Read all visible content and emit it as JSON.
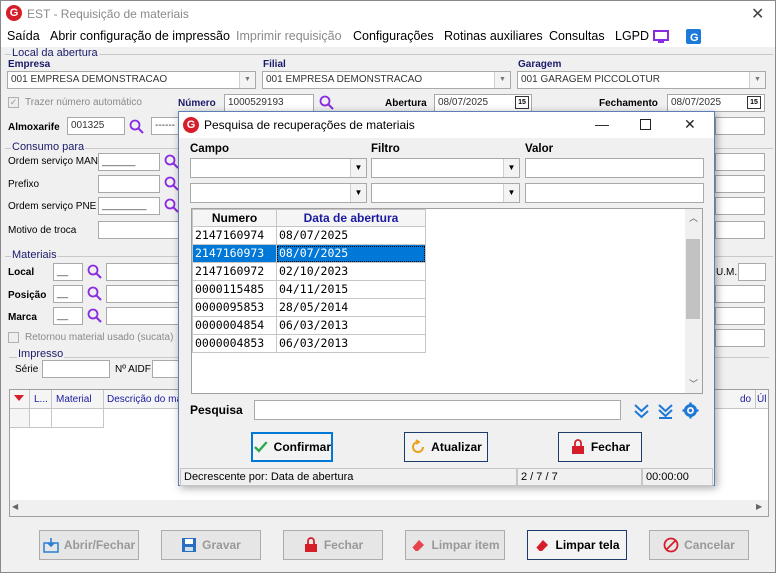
{
  "window": {
    "title": "EST - Requisição de materiais",
    "close": "✕"
  },
  "menu": [
    "Saída",
    "Abrir configuração de impressão",
    "Imprimir requisição",
    "Configurações",
    "Rotinas auxiliares",
    "Consultas",
    "LGPD"
  ],
  "local": {
    "group_title": "Local da abertura",
    "empresa_label": "Empresa",
    "empresa_value": "001 EMPRESA DEMONSTRACAO",
    "filial_label": "Filial",
    "filial_value": "001 EMPRESA DEMONSTRACAO",
    "garagem_label": "Garagem",
    "garagem_value": "001 GARAGEM PICCOLOTUR",
    "trazer_label": "Trazer número automático",
    "numero_label": "Número",
    "numero_value": "1000529193",
    "abertura_label": "Abertura",
    "abertura_value": "08/07/2025",
    "fechamento_label": "Fechamento",
    "fechamento_value": "08/07/2025",
    "almox_label": "Almoxarife",
    "almox_value": "001325",
    "almox_desc": "------"
  },
  "consumo": {
    "group_title": "Consumo para",
    "os_man_label": "Ordem serviço MAN",
    "os_man_value": "______",
    "prefixo_label": "Prefixo",
    "os_pne_label": "Ordem serviço PNE",
    "os_pne_value": "________",
    "motivo_label": "Motivo de troca"
  },
  "materiais": {
    "group_title": "Materiais",
    "local_label": "Local",
    "local_value": "__",
    "posicao_label": "Posição",
    "posicao_value": "__",
    "marca_label": "Marca",
    "marca_value": "__",
    "retornou_label": "Retornou material usado (sucata)",
    "um_label": "U.M."
  },
  "impresso": {
    "group_title": "Impresso",
    "serie_label": "Série",
    "aidf_label": "Nº AIDF"
  },
  "items_table": {
    "headers": [
      "L...",
      "Material",
      "Descrição do mat"
    ],
    "right_headers": [
      "do",
      "Úl"
    ]
  },
  "bottom_buttons": {
    "abrir": "Abrir/Fechar",
    "gravar": "Gravar",
    "fechar": "Fechar",
    "limpar_item": "Limpar item",
    "limpar_tela": "Limpar tela",
    "cancelar": "Cancelar"
  },
  "modal": {
    "title": "Pesquisa de recuperações de materiais",
    "campo_label": "Campo",
    "filtro_label": "Filtro",
    "valor_label": "Valor",
    "columns": [
      "Numero",
      "Data de abertura"
    ],
    "rows": [
      {
        "numero": "2147160974",
        "data": "08/07/2025"
      },
      {
        "numero": "2147160973",
        "data": "08/07/2025"
      },
      {
        "numero": "2147160972",
        "data": "02/10/2023"
      },
      {
        "numero": "0000115485",
        "data": "04/11/2015"
      },
      {
        "numero": "0000095853",
        "data": "28/05/2014"
      },
      {
        "numero": "0000004854",
        "data": "06/03/2013"
      },
      {
        "numero": "0000004853",
        "data": "06/03/2013"
      }
    ],
    "selected_row": 1,
    "pesquisa_label": "Pesquisa",
    "confirmar": "Confirmar",
    "atualizar": "Atualizar",
    "fechar": "Fechar",
    "status_sort": "Decrescente por: Data de abertura",
    "status_count": "2 / 7 / 7",
    "status_time": "00:00:00"
  },
  "colors": {
    "brand": "#d61e2b",
    "selection": "#0078d7",
    "header_blue": "#1a1aa0"
  }
}
